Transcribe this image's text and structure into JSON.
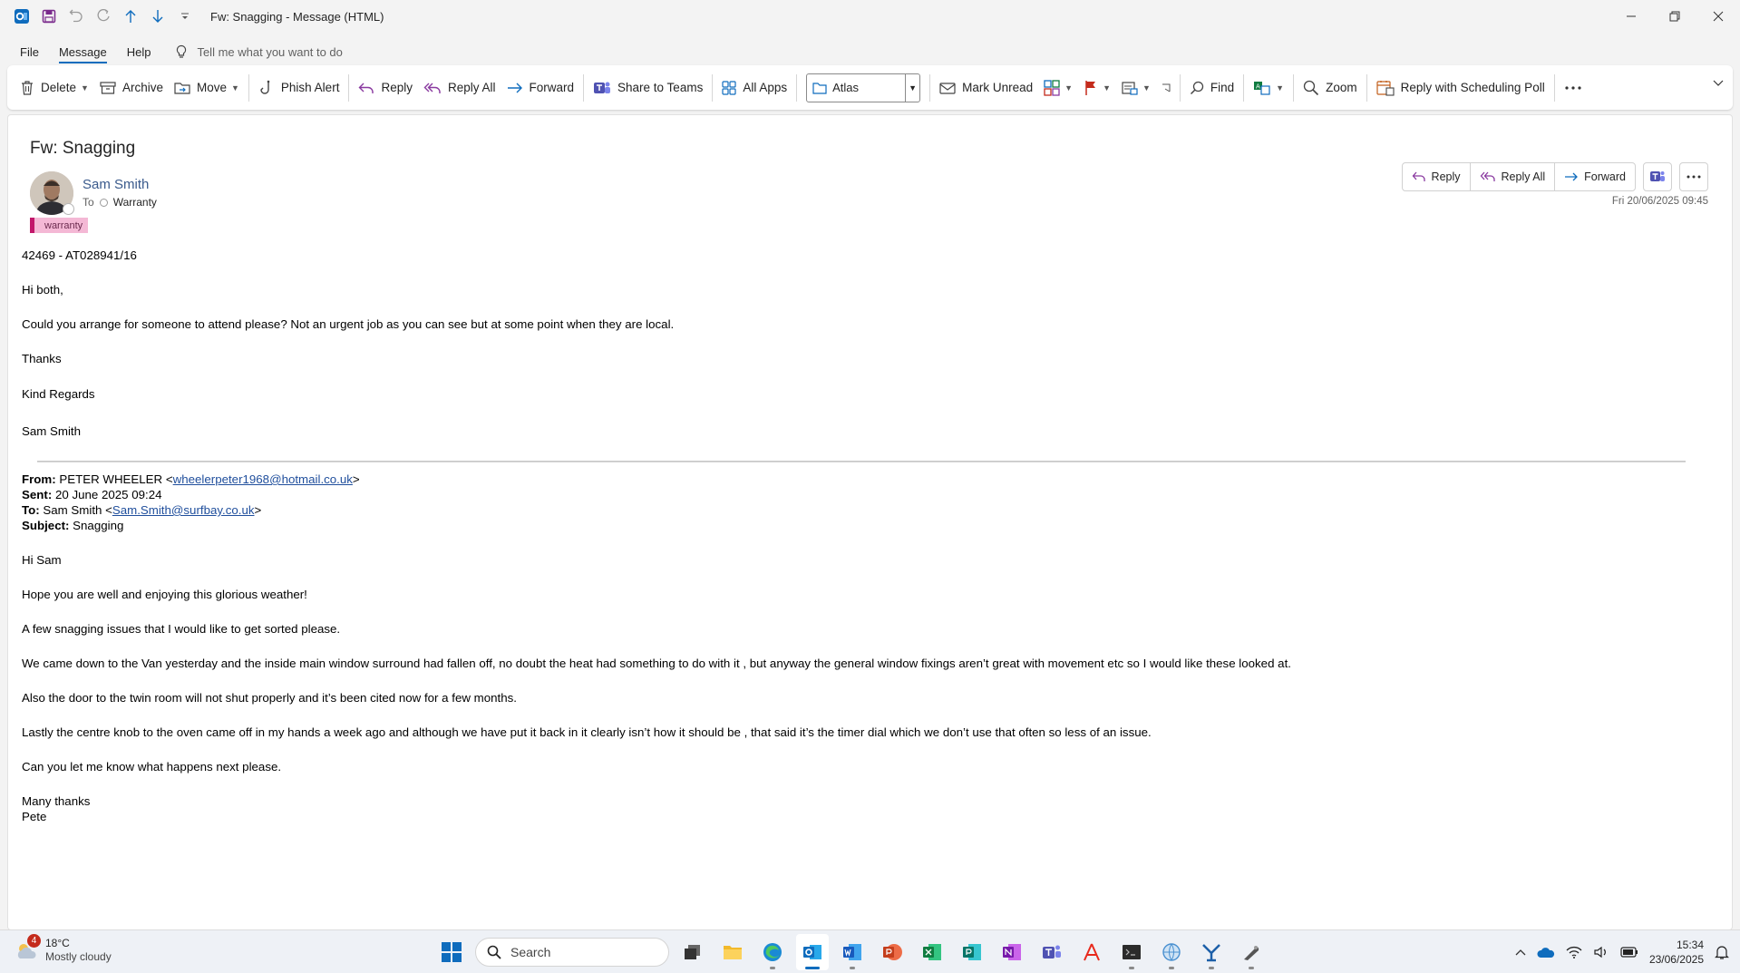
{
  "window": {
    "title": "Fw: Snagging  -  Message (HTML)"
  },
  "menu": {
    "tabs": [
      "File",
      "Message",
      "Help"
    ],
    "active_tab": "Message",
    "tell_me": "Tell me what you want to do"
  },
  "ribbon": {
    "delete": "Delete",
    "archive": "Archive",
    "move": "Move",
    "phish_alert": "Phish Alert",
    "reply": "Reply",
    "reply_all": "Reply All",
    "forward": "Forward",
    "share_to_teams": "Share to Teams",
    "all_apps": "All Apps",
    "quick_step_value": "Atlas",
    "mark_unread": "Mark Unread",
    "find": "Find",
    "zoom": "Zoom",
    "reply_scheduling_poll": "Reply with Scheduling Poll"
  },
  "message": {
    "subject": "Fw: Snagging",
    "sender": "Sam Smith",
    "to_label": "To",
    "recipient": "Warranty",
    "category": "warranty",
    "date": "Fri 20/06/2025 09:45",
    "actions": {
      "reply": "Reply",
      "reply_all": "Reply All",
      "forward": "Forward"
    },
    "body": {
      "ref": "42469 - AT028941/16",
      "greeting": "Hi both,",
      "para1": "Could you arrange for someone to attend please? Not an urgent job as you can see but at some point when they are local.",
      "thanks": "Thanks",
      "regards": "Kind Regards",
      "signature": "Sam Smith"
    },
    "forwarded": {
      "from_label": "From:",
      "from_name": "PETER WHEELER <",
      "from_email": "wheelerpeter1968@hotmail.co.uk",
      "from_close": ">",
      "sent_label": "Sent:",
      "sent": "20 June 2025 09:24",
      "to_label": "To:",
      "to_name": "Sam Smith <",
      "to_email": "Sam.Smith@surfbay.co.uk",
      "to_close": ">",
      "subject_label": "Subject:",
      "subject": "Snagging",
      "greeting": "Hi Sam",
      "p1": "Hope you are well and enjoying this glorious weather!",
      "p2": "A few snagging issues that I would like to get sorted please.",
      "p3": "We came down to the Van yesterday and the inside main window surround had fallen off, no doubt the heat had something to do with it , but anyway the general window fixings aren’t great with movement etc so I would like these looked at.",
      "p4": "Also the door to the twin room will not shut properly and it’s been cited now for a few months.",
      "p5": "Lastly the centre knob to the oven came off in my hands a week ago and although we have put it back in it clearly isn’t how it should be , that said it’s the timer dial which we don’t use that often so less of an issue.",
      "p6": "Can you let me know what happens next please.",
      "closing": "Many thanks",
      "name": "Pete"
    }
  },
  "taskbar": {
    "weather_temp": "18°C",
    "weather_desc": "Mostly cloudy",
    "weather_badge": "4",
    "search_placeholder": "Search",
    "time": "15:34",
    "date": "23/06/2025"
  },
  "colors": {
    "accent": "#0f6cbd",
    "category_fill": "#f4b8d5",
    "flag_red": "#c42b1c",
    "link": "#1f4e9c"
  }
}
